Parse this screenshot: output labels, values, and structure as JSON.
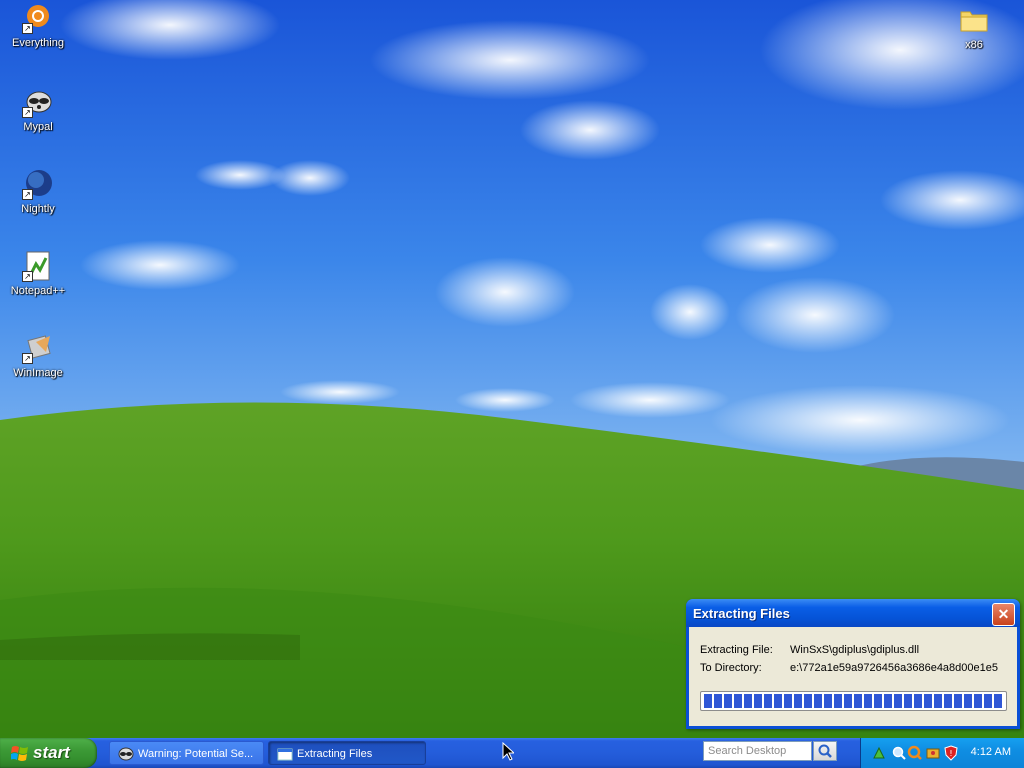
{
  "desktop": {
    "icons": [
      {
        "label": "Everything",
        "icon": "everything-icon"
      },
      {
        "label": "Mypal",
        "icon": "mypal-icon"
      },
      {
        "label": "Nightly",
        "icon": "nightly-icon"
      },
      {
        "label": "Notepad++",
        "icon": "notepadpp-icon"
      },
      {
        "label": "WinImage",
        "icon": "winimage-icon"
      },
      {
        "label": "x86",
        "icon": "folder-icon"
      }
    ]
  },
  "dialog": {
    "title": "Extracting Files",
    "file_label": "Extracting File:",
    "file_value": "WinSxS\\gdiplus\\gdiplus.dll",
    "dir_label": "To Directory:",
    "dir_value": "e:\\772a1e59a9726456a3686e4a8d00e1e5",
    "progress": 1.0
  },
  "taskbar": {
    "start_label": "start",
    "tasks": [
      {
        "label": "Warning: Potential Se...",
        "active": false
      },
      {
        "label": "Extracting Files",
        "active": true
      }
    ],
    "search_placeholder": "Search Desktop",
    "clock": "4:12 AM"
  },
  "colors": {
    "taskbar_blue": "#245ddb",
    "start_green": "#3c9a36",
    "tray_blue": "#0f8ee3",
    "progress_blue": "#2f57d6",
    "dialog_face": "#ece9d8"
  }
}
